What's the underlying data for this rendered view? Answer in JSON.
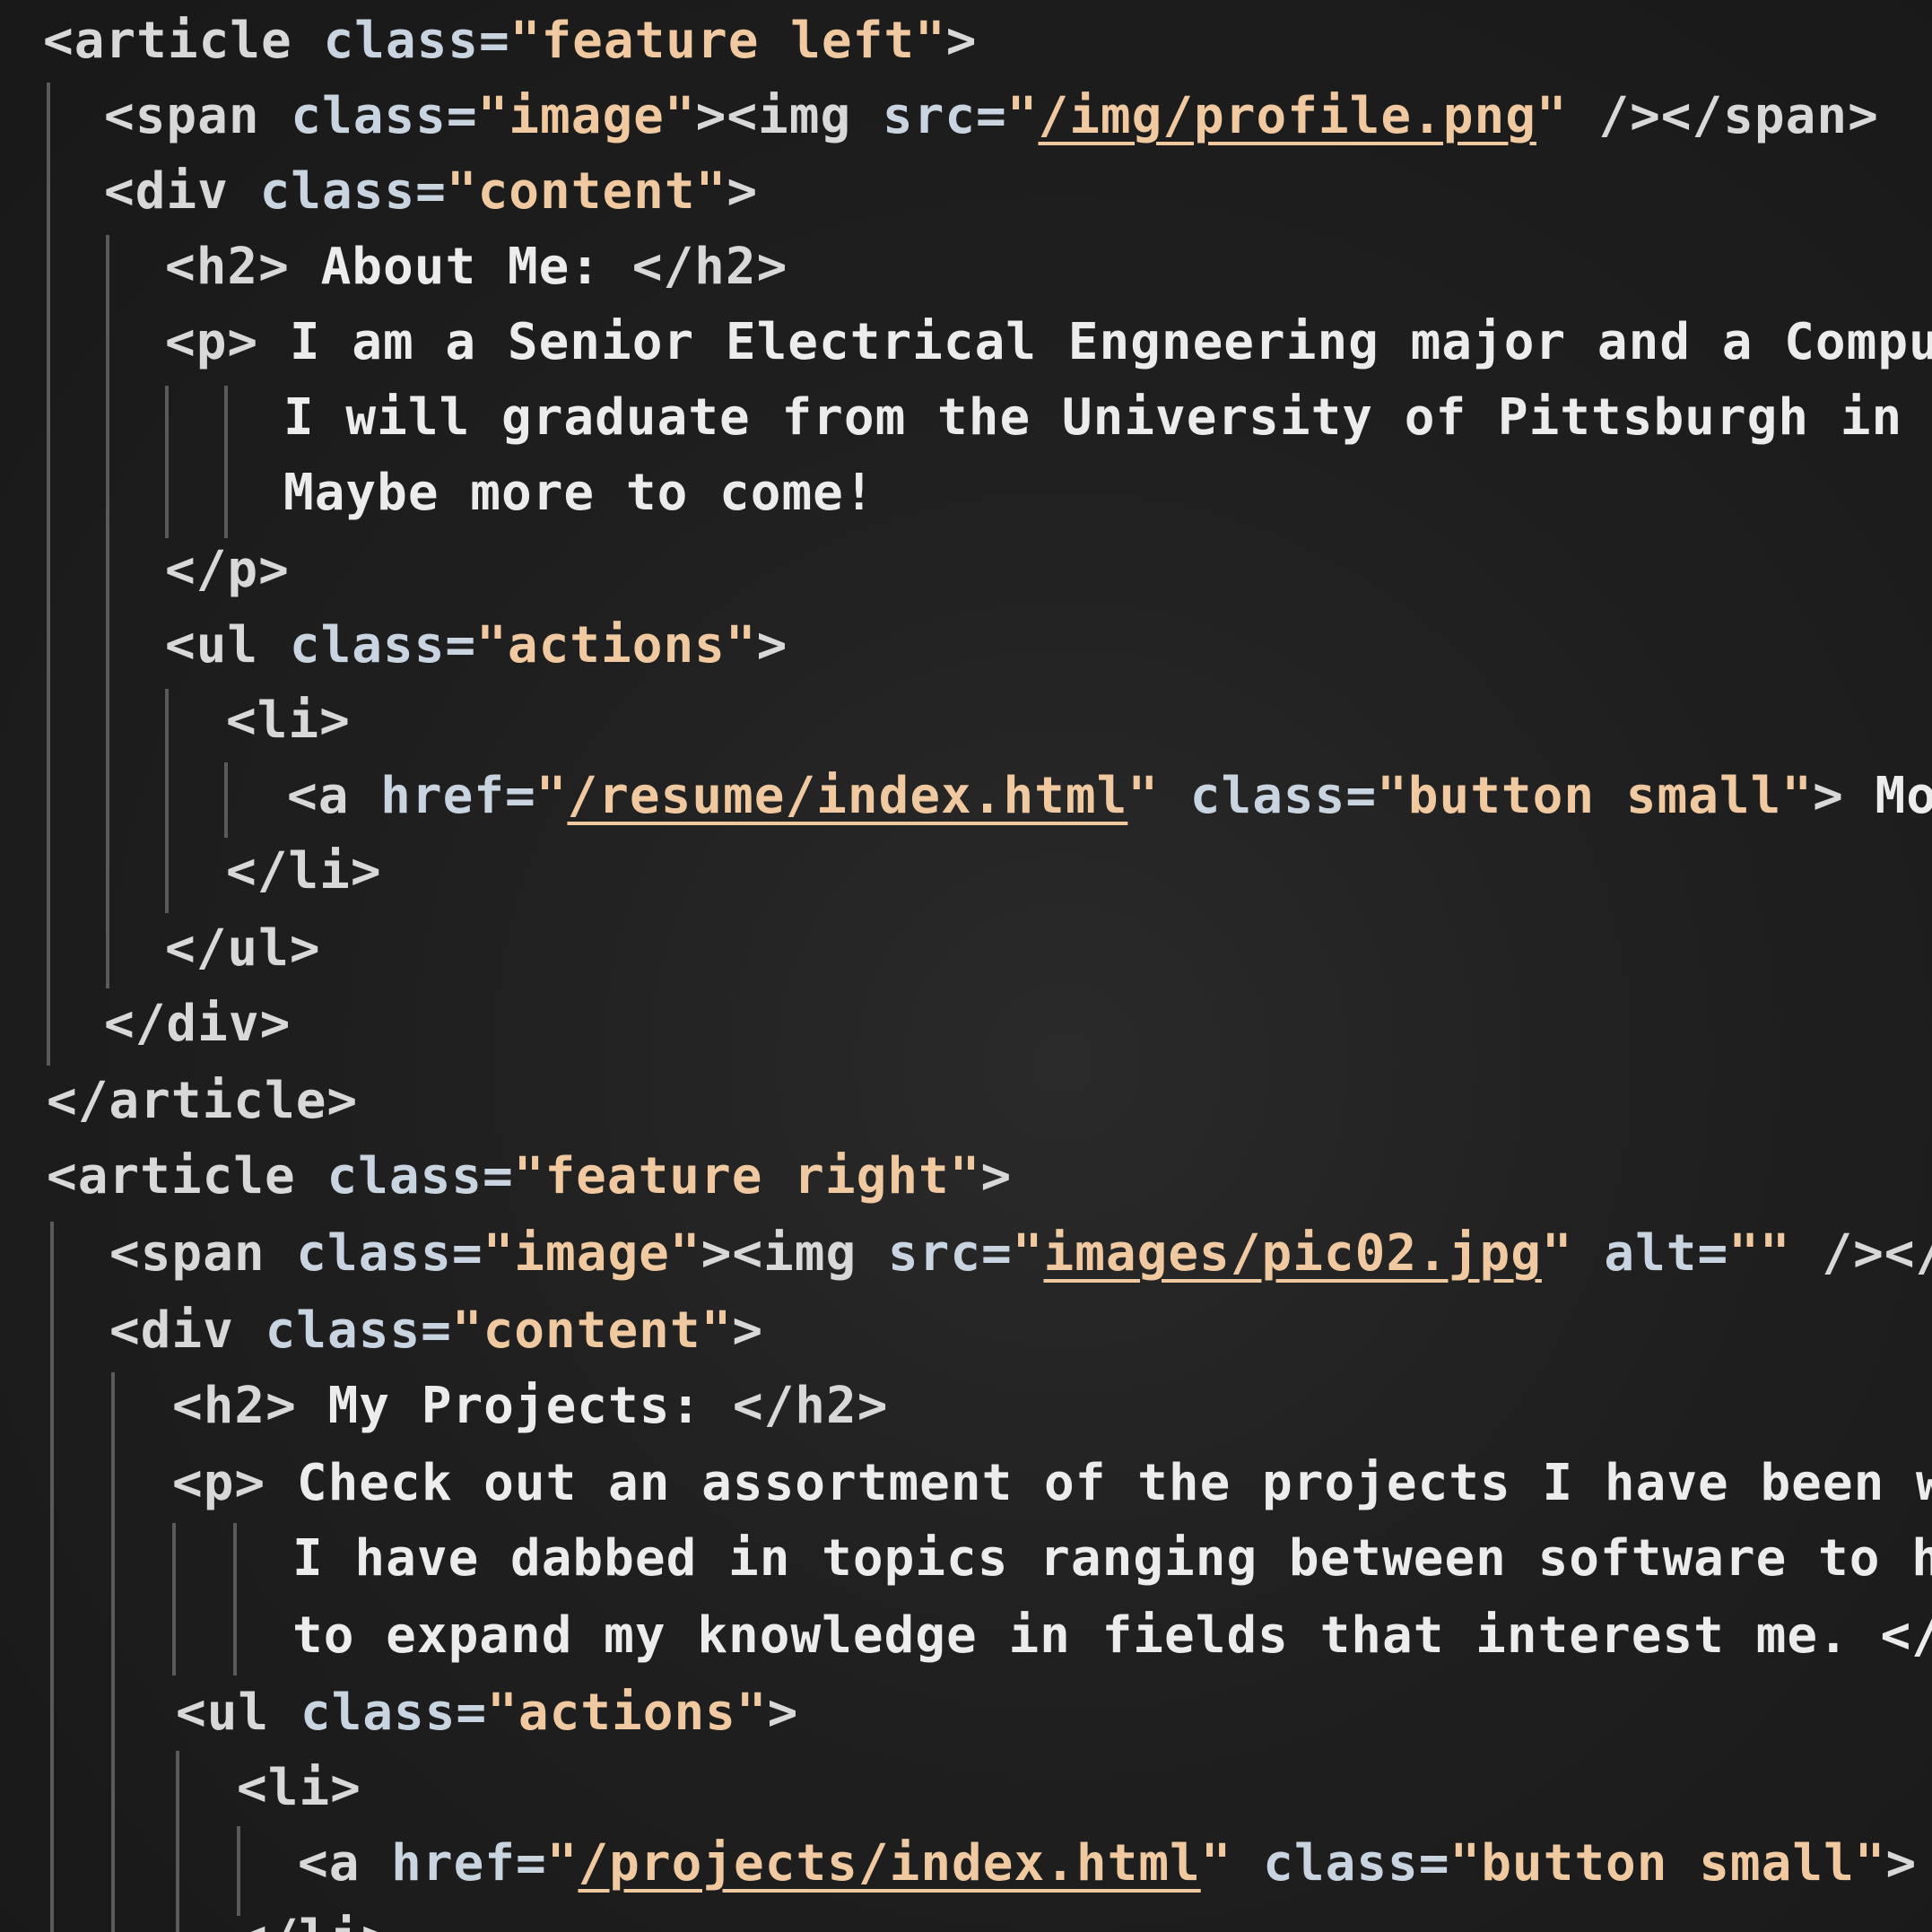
{
  "code": {
    "l1": [
      "<article ",
      "class=",
      "\"feature left\"",
      ">"
    ],
    "l2": [
      "<span ",
      "class=",
      "\"image\"",
      "><img ",
      "src=",
      "\"",
      "/img/profile.png",
      "\"",
      " /></span>"
    ],
    "l3": [
      "<div ",
      "class=",
      "\"content\"",
      ">"
    ],
    "l4": [
      "<h2> ",
      "About Me: ",
      "</h2>"
    ],
    "l5": [
      "<p> ",
      "I am a Senior Electrical Engneering major and a Comput"
    ],
    "l6": [
      "I will graduate from the University of Pittsburgh in S"
    ],
    "l7": [
      "Maybe more to come!"
    ],
    "l8": [
      "</p>"
    ],
    "l9": [
      "<ul ",
      "class=",
      "\"actions\"",
      ">"
    ],
    "l10": [
      "<li>"
    ],
    "l11": [
      "<a ",
      "href=",
      "\"",
      "/resume/index.html",
      "\"",
      " class=",
      "\"button small\"",
      "> ",
      "Mor"
    ],
    "l12": [
      "</li>"
    ],
    "l13": [
      "</ul>"
    ],
    "l14": [
      "</div>"
    ],
    "l15": [
      "</article>"
    ],
    "l16": [
      "<article ",
      "class=",
      "\"feature right\"",
      ">"
    ],
    "l17": [
      "<span ",
      "class=",
      "\"image\"",
      "><img ",
      "src=",
      "\"",
      "images/pic02.jpg",
      "\"",
      " alt=",
      "\"\"",
      " /></"
    ],
    "l18": [
      "<div ",
      "class=",
      "\"content\"",
      ">"
    ],
    "l19": [
      "<h2> ",
      "My Projects: ",
      "</h2>"
    ],
    "l20": [
      "<p> ",
      "Check out an assortment of the projects I have been w"
    ],
    "l21": [
      "I have dabbed in topics ranging between software to h"
    ],
    "l22": [
      "to expand my knowledge in fields that interest me. </"
    ],
    "l23": [
      "<ul ",
      "class=",
      "\"actions\"",
      ">"
    ],
    "l24": [
      "<li>"
    ],
    "l25": [
      "<a ",
      "href=",
      "\"",
      "/projects/index.html",
      "\"",
      " class=",
      "\"button small\"",
      ">"
    ],
    "l26": [
      "</li>"
    ]
  }
}
